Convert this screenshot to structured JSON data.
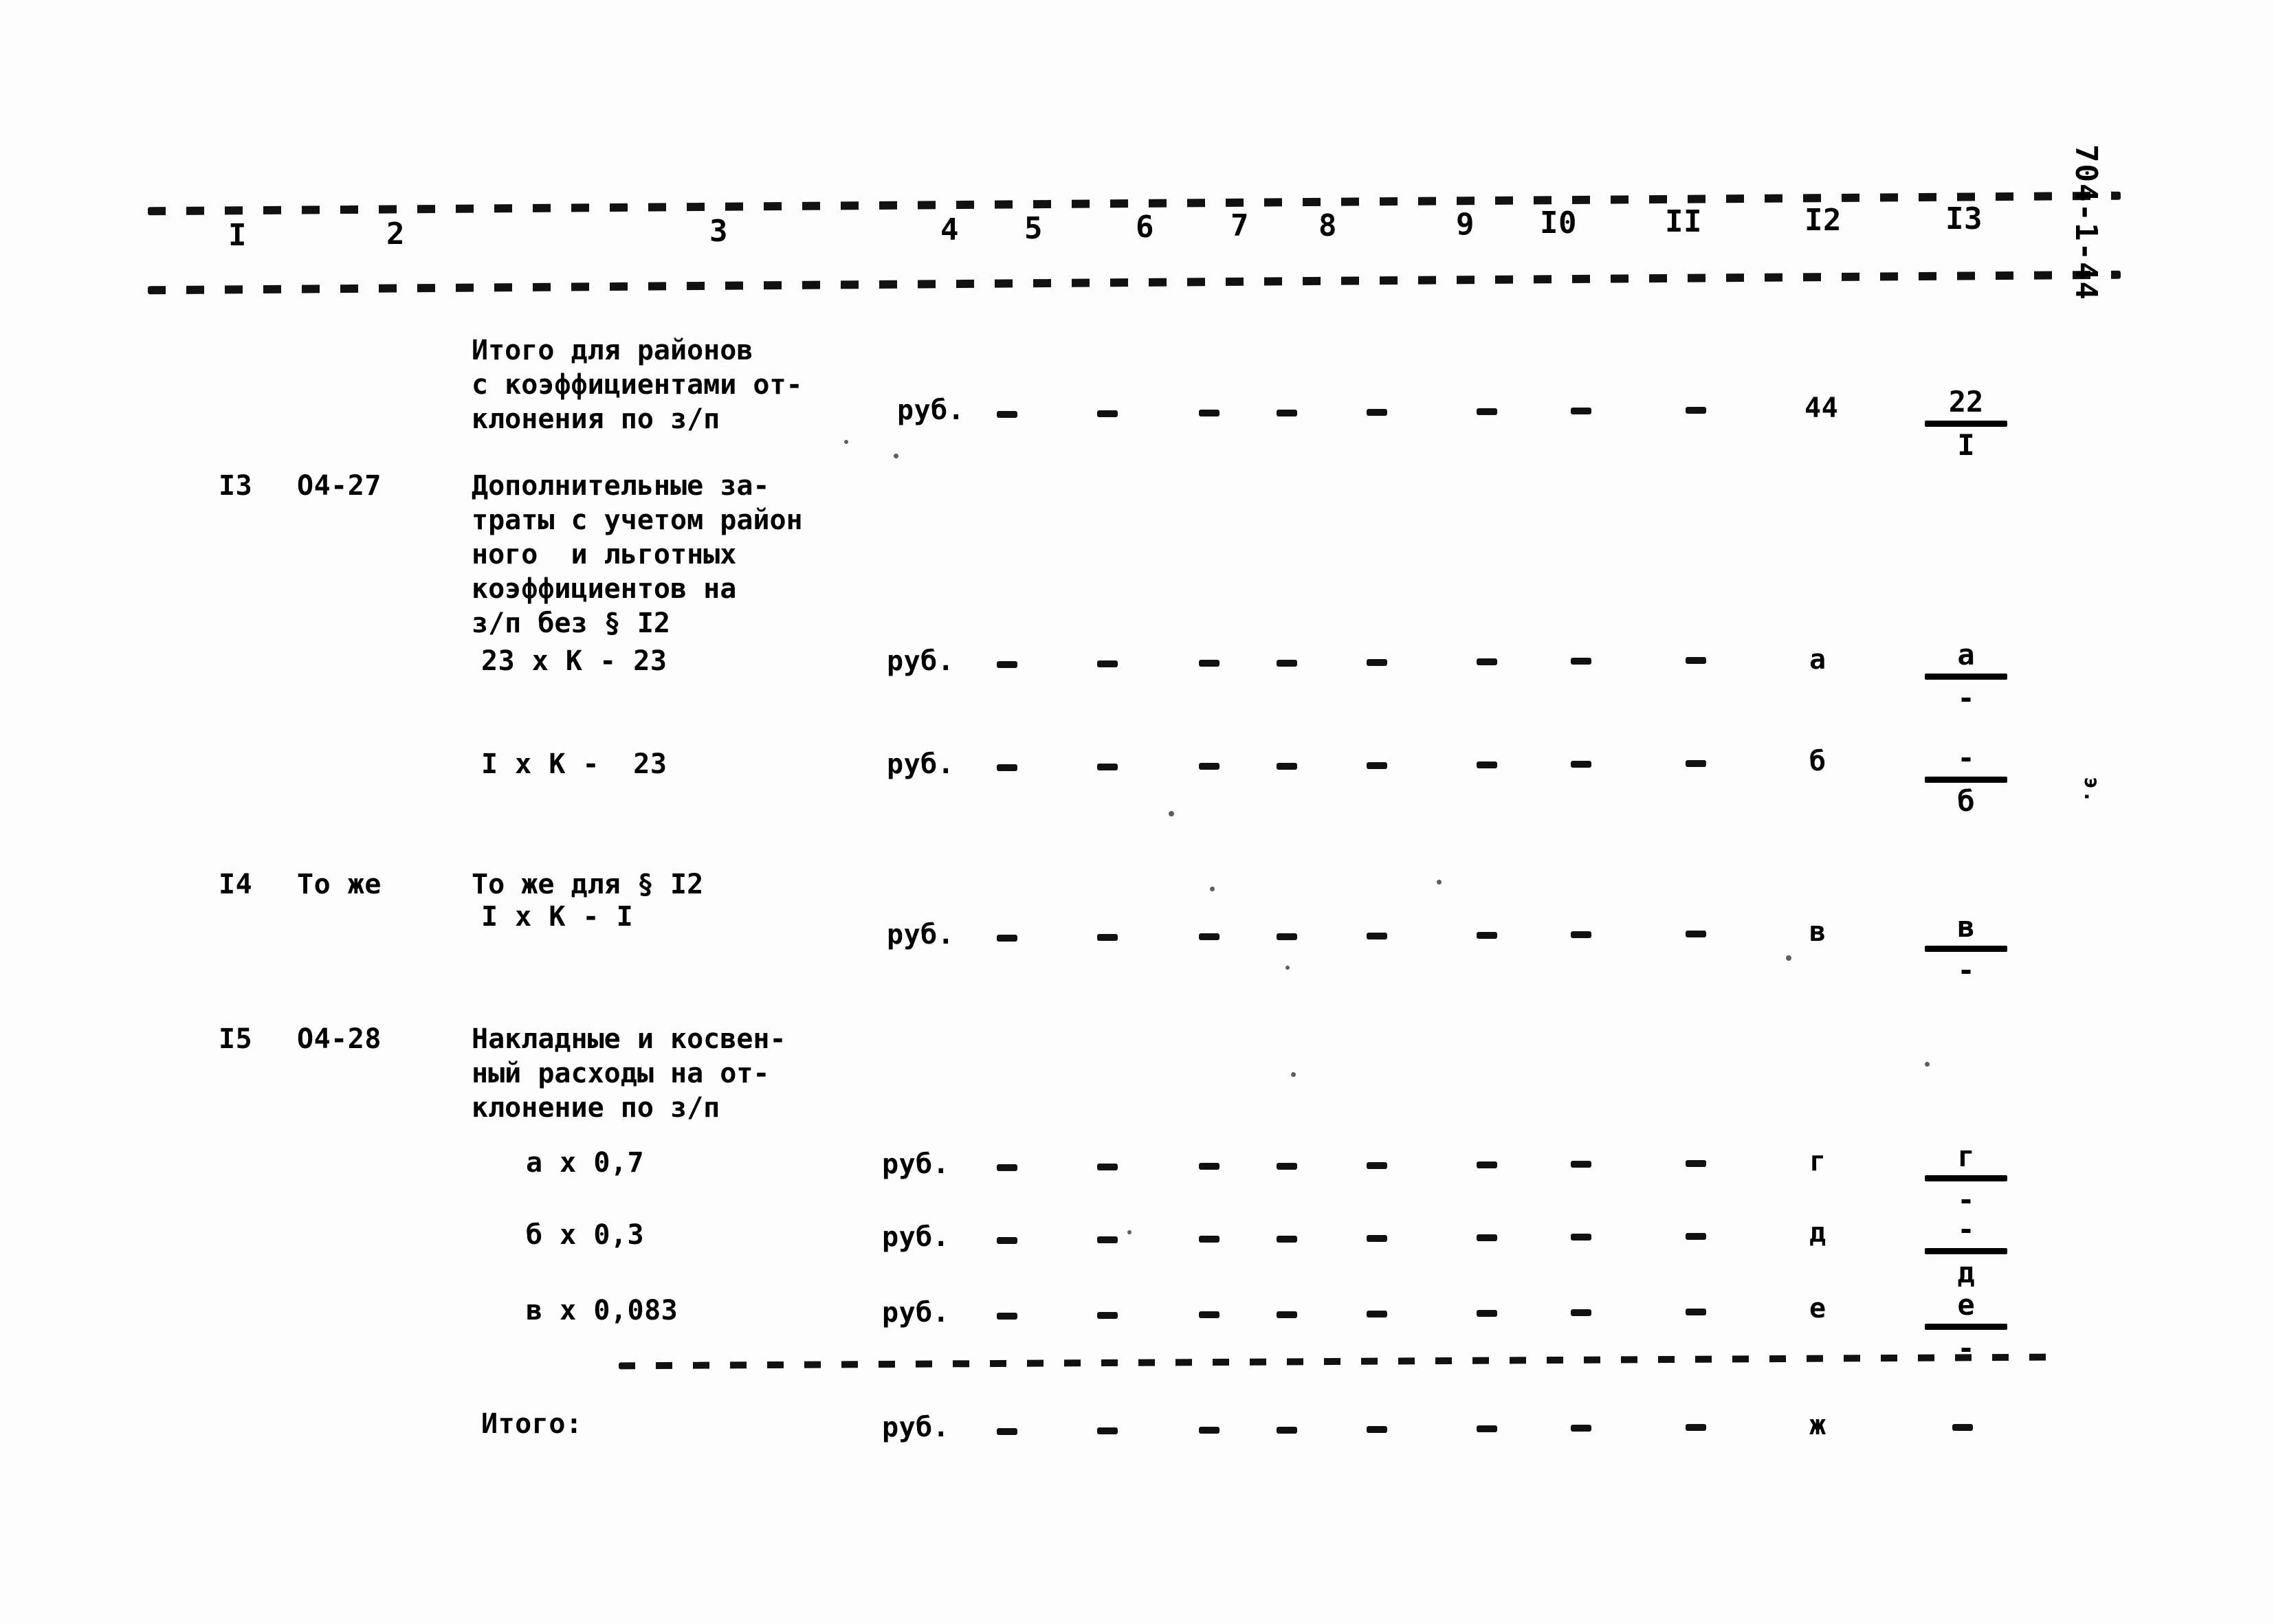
{
  "document": {
    "margin_stamp": "704-1-44",
    "margin_mark_mid": "э.",
    "page_kind": "scanned-typewritten-table"
  },
  "table": {
    "column_headers": [
      "I",
      "2",
      "3",
      "4",
      "5",
      "6",
      "7",
      "8",
      "9",
      "I0",
      "II",
      "I2",
      "I3"
    ],
    "dash_placeholder": "-",
    "unit_label": "руб.",
    "rows": [
      {
        "no": "",
        "code": "",
        "description": "Итого для районов\nс коэффициентами от-\nклонения по з/п",
        "unit": "руб.",
        "cells": [
          "-",
          "-",
          "-",
          "-",
          "-",
          "-",
          "-",
          "-"
        ],
        "col12": "44",
        "col13_numerator": "22",
        "col13_denominator": "I"
      },
      {
        "no": "I3",
        "code": "О4-27",
        "description": "Дополнительные за-\nтраты с учетом район\nного  и льготных\nкоэффициентов на\nз/п без § I2",
        "formula": "23 х К - 23",
        "unit": "руб.",
        "cells": [
          "-",
          "-",
          "-",
          "-",
          "-",
          "-",
          "-",
          "-"
        ],
        "col12": "а",
        "col13_numerator": "а",
        "col13_denominator": "-"
      },
      {
        "no": "",
        "code": "",
        "description": "",
        "formula": "I х К -  23",
        "unit": "руб.",
        "cells": [
          "-",
          "-",
          "-",
          "-",
          "-",
          "-",
          "-",
          "-"
        ],
        "col12": "б",
        "col13_numerator": "-",
        "col13_denominator": "б"
      },
      {
        "no": "I4",
        "code": "То же",
        "description": "То же для § I2",
        "formula": "I х К - I",
        "unit": "руб.",
        "cells": [
          "-",
          "-",
          "-",
          "-",
          "-",
          "-",
          "-",
          "-"
        ],
        "col12": "в",
        "col13_numerator": "в",
        "col13_denominator": "-"
      },
      {
        "no": "I5",
        "code": "О4-28",
        "description": "Накладные и косвен-\nный расходы на от-\nклонение по з/п",
        "formula": "а х 0,7",
        "unit": "руб.",
        "cells": [
          "-",
          "-",
          "-",
          "-",
          "-",
          "-",
          "-",
          "-"
        ],
        "col12": "г",
        "col13_numerator": "г",
        "col13_denominator": "-"
      },
      {
        "no": "",
        "code": "",
        "description": "",
        "formula": "б х 0,3",
        "unit": "руб.",
        "cells": [
          "-",
          "-",
          "-",
          "-",
          "-",
          "-",
          "-",
          "-"
        ],
        "col12": "д",
        "col13_numerator": "-",
        "col13_denominator": "д"
      },
      {
        "no": "",
        "code": "",
        "description": "",
        "formula": "в х 0,083",
        "unit": "руб.",
        "cells": [
          "-",
          "-",
          "-",
          "-",
          "-",
          "-",
          "-",
          "-"
        ],
        "col12": "е",
        "col13_numerator": "е",
        "col13_denominator": "-"
      }
    ],
    "total_row": {
      "label": "Итого:",
      "unit": "руб.",
      "cells": [
        "-",
        "-",
        "-",
        "-",
        "-",
        "-",
        "-",
        "-"
      ],
      "col12": "ж",
      "col13": "-"
    }
  }
}
